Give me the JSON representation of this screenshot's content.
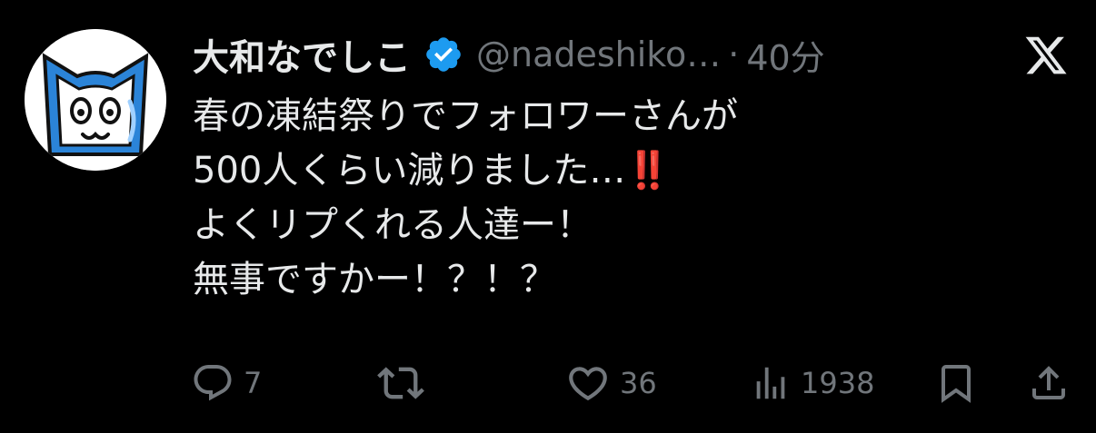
{
  "tweet": {
    "author_name": "大和なでしこ",
    "handle": "@nadeshiko…",
    "separator": "·",
    "time": "40分",
    "verified": true,
    "lines": [
      "春の凍結祭りでフォロワーさんが",
      "500人くらい減りました…",
      "よくリプくれる人達ー！",
      "無事ですかー！？！？"
    ],
    "emoji_after_line2": "‼️"
  },
  "stats": {
    "replies": "7",
    "likes": "36",
    "views": "1938"
  },
  "icons": {
    "verified": "verified-badge-icon",
    "platform": "x-logo-icon",
    "reply": "reply-icon",
    "retweet": "retweet-icon",
    "like": "heart-icon",
    "views": "views-icon",
    "bookmark": "bookmark-icon",
    "share": "share-icon"
  },
  "colors": {
    "background": "#000000",
    "text": "#e7e9ea",
    "muted": "#71767b",
    "verified": "#1d9bf0",
    "emoji_red": "#e0312b"
  }
}
